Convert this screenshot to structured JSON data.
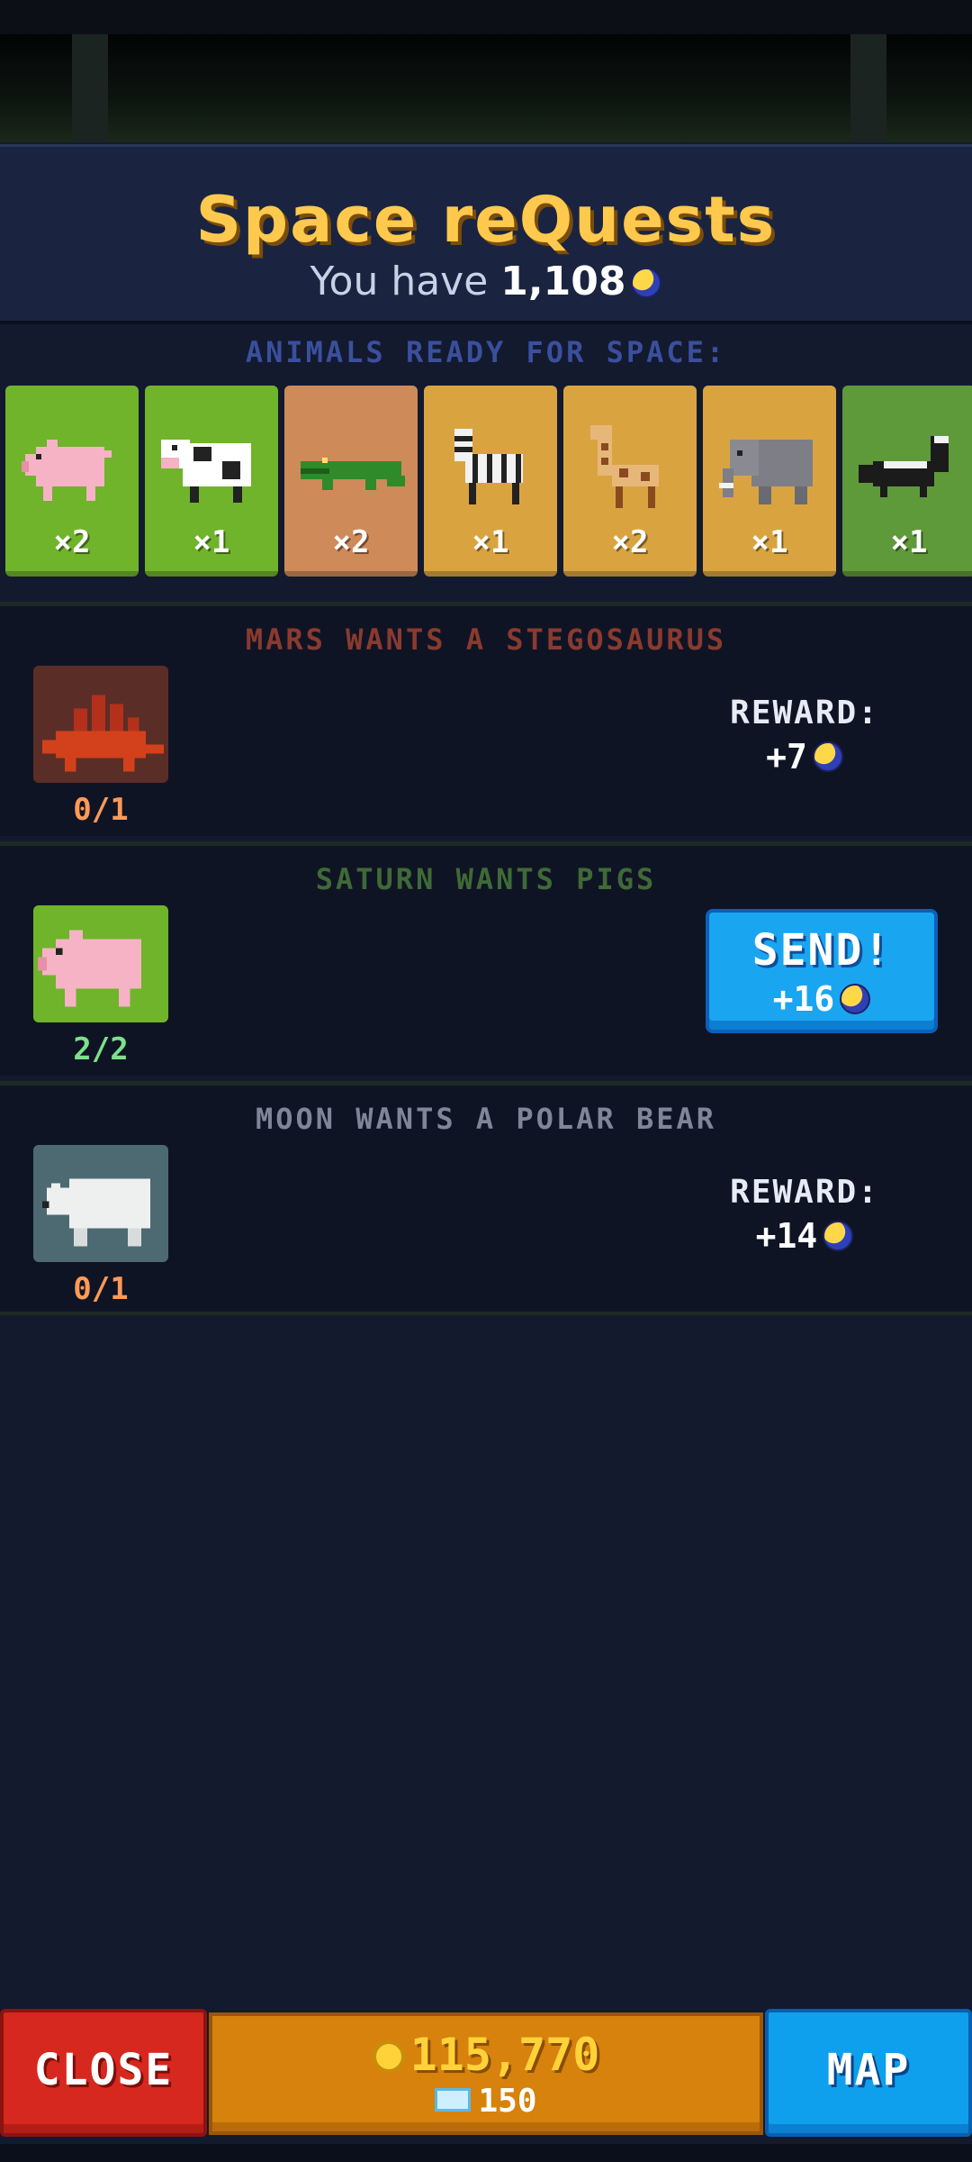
{
  "header": {
    "title": "Space reQuests",
    "balance_prefix": "You have",
    "balance_value": "1,108"
  },
  "ready": {
    "label": "ANIMALS READY FOR SPACE:",
    "animals": [
      {
        "name": "pig",
        "count": "×2",
        "bg": "green"
      },
      {
        "name": "cow",
        "count": "×1",
        "bg": "green"
      },
      {
        "name": "crocodile",
        "count": "×2",
        "bg": "clay"
      },
      {
        "name": "zebra",
        "count": "×1",
        "bg": "sand"
      },
      {
        "name": "giraffe",
        "count": "×2",
        "bg": "sand"
      },
      {
        "name": "elephant",
        "count": "×1",
        "bg": "sand"
      },
      {
        "name": "skunk",
        "count": "×1",
        "bg": "olive"
      }
    ]
  },
  "quests": [
    {
      "title": "MARS WANTS A STEGOSAURUS",
      "progress": "0/1",
      "reward_label": "REWARD:",
      "reward_value": "+7"
    },
    {
      "title": "SATURN WANTS PIGS",
      "progress": "2/2",
      "send_label": "SEND!",
      "reward_value": "+16"
    },
    {
      "title": "MOON WANTS A POLAR BEAR",
      "progress": "0/1",
      "reward_label": "REWARD:",
      "reward_value": "+14"
    }
  ],
  "bottom": {
    "close_label": "CLOSE",
    "coins": "115,770",
    "gems": "150",
    "map_label": "MAP"
  },
  "colors": {
    "title": "#ffc94d",
    "mars": "#8a3a2e",
    "saturn": "#3f6a36",
    "moon": "#7e8698",
    "progress_incomplete": "#ff9a57",
    "progress_complete": "#7de08a"
  }
}
